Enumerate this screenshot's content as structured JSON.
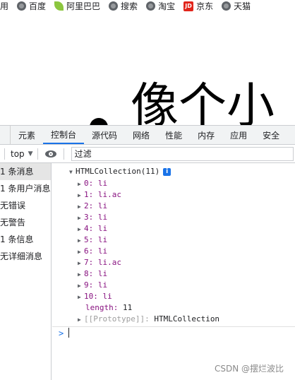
{
  "bookmarks": [
    {
      "label": "用",
      "icon": "none"
    },
    {
      "label": "百度",
      "icon": "globe-icon"
    },
    {
      "label": "阿里巴巴",
      "icon": "leaf-icon"
    },
    {
      "label": "搜索",
      "icon": "globe-icon"
    },
    {
      "label": "淘宝",
      "icon": "globe-icon"
    },
    {
      "label": "京东",
      "icon": "jd-icon",
      "badge": "JD"
    },
    {
      "label": "天猫",
      "icon": "globe-icon"
    }
  ],
  "page": {
    "big_text": "像个小"
  },
  "devtools": {
    "tabs": [
      "元素",
      "控制台",
      "源代码",
      "网络",
      "性能",
      "内存",
      "应用",
      "安全"
    ],
    "active_tab": "控制台",
    "context": "top",
    "filter_placeholder": "过滤",
    "sidebar": [
      "1 条消息",
      "1 条用户消息",
      "无错误",
      "无警告",
      "1 条信息",
      "无详细消息"
    ],
    "console": {
      "header": "HTMLCollection(11)",
      "info_badge": "i",
      "items": [
        {
          "key": "0:",
          "value": "li"
        },
        {
          "key": "1:",
          "value": "li.ac"
        },
        {
          "key": "2:",
          "value": "li"
        },
        {
          "key": "3:",
          "value": "li"
        },
        {
          "key": "4:",
          "value": "li"
        },
        {
          "key": "5:",
          "value": "li"
        },
        {
          "key": "6:",
          "value": "li"
        },
        {
          "key": "7:",
          "value": "li.ac"
        },
        {
          "key": "8:",
          "value": "li"
        },
        {
          "key": "9:",
          "value": "li"
        },
        {
          "key": "10:",
          "value": "li"
        }
      ],
      "length_key": "length:",
      "length_value": "11",
      "prototype_key": "[[Prototype]]:",
      "prototype_value": "HTMLCollection",
      "prompt": ">"
    }
  },
  "watermark": "CSDN @摆烂波比",
  "colors": {
    "accent": "#1a73e8",
    "key": "#881280",
    "panel_bg": "#f1f3f4"
  }
}
